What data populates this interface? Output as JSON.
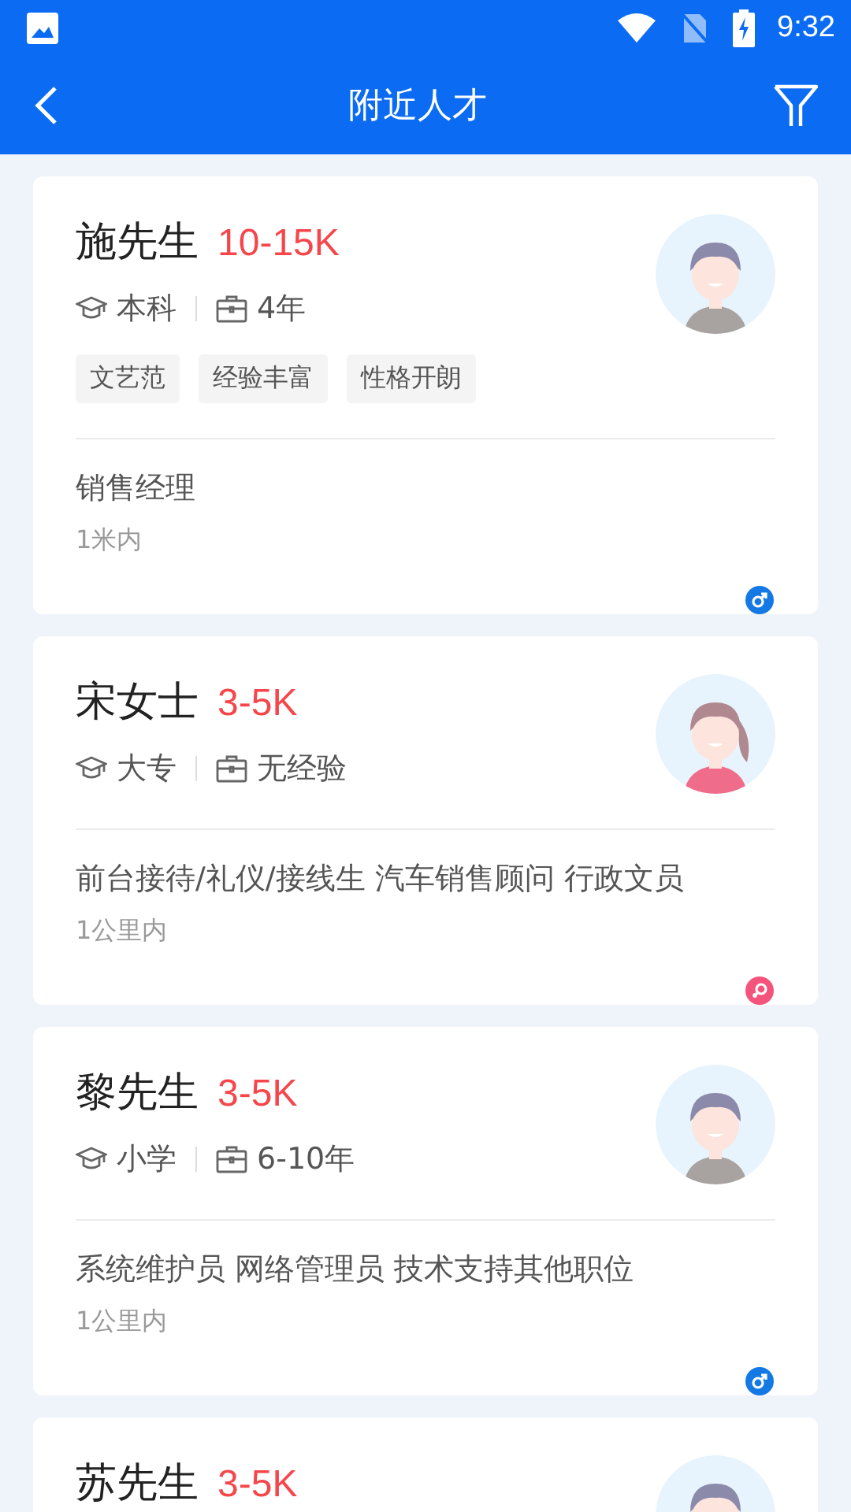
{
  "status_bar": {
    "time": "9:32"
  },
  "app_bar": {
    "title": "附近人才"
  },
  "candidates": [
    {
      "name": "施先生",
      "salary": "10-15K",
      "kind": "male",
      "education": "本科",
      "experience": "4年",
      "tags": [
        "文艺范",
        "经验丰富",
        "性格开朗"
      ],
      "positions": "销售经理",
      "distance": "1米内"
    },
    {
      "name": "宋女士",
      "salary": "3-5K",
      "kind": "female",
      "education": "大专",
      "experience": "无经验",
      "positions": "前台接待/礼仪/接线生 汽车销售顾问 行政文员",
      "distance": "1公里内"
    },
    {
      "name": "黎先生",
      "salary": "3-5K",
      "kind": "male",
      "education": "小学",
      "experience": "6-10年",
      "positions": "系统维护员 网络管理员 技术支持其他职位",
      "distance": "1公里内"
    },
    {
      "name": "苏先生",
      "salary": "3-5K",
      "kind": "male"
    }
  ]
}
